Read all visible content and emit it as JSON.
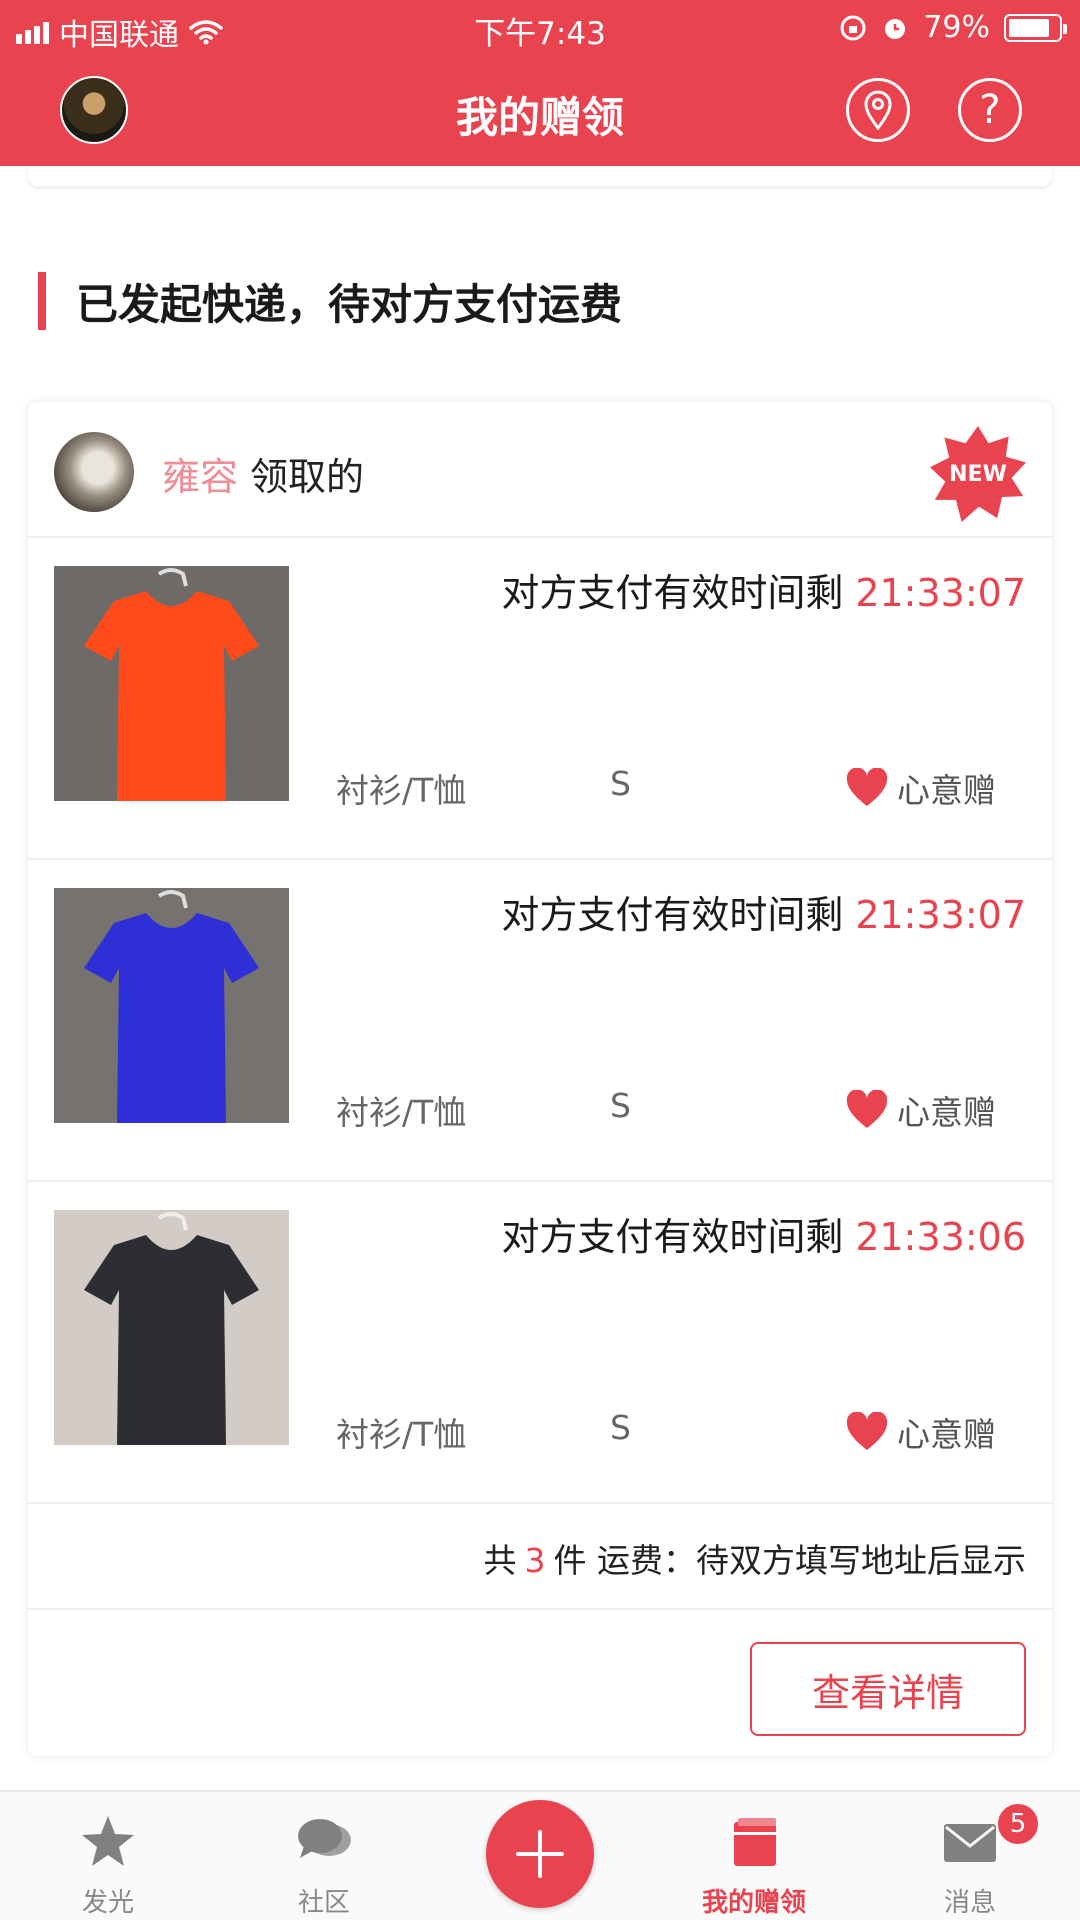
{
  "status_bar": {
    "carrier": "中国联通",
    "time": "下午7:43",
    "battery_percent": "79%",
    "battery_level": 0.79
  },
  "header": {
    "title": "我的赠领",
    "location_icon": "location-pin-icon",
    "help_icon": "help-question-icon"
  },
  "section": {
    "title": "已发起快递，待对方支付运费"
  },
  "card": {
    "receiver_name": "雍容",
    "receiver_suffix": "领取的",
    "new_badge": "NEW",
    "items": [
      {
        "timer_label": "对方支付有效时间剩",
        "timer": "21:33:07",
        "category": "衬衫/T恤",
        "size": "S",
        "gift_type": "心意赠",
        "color": "#ff4a1c"
      },
      {
        "timer_label": "对方支付有效时间剩",
        "timer": "21:33:07",
        "category": "衬衫/T恤",
        "size": "S",
        "gift_type": "心意赠",
        "color": "#2e2fd6"
      },
      {
        "timer_label": "对方支付有效时间剩",
        "timer": "21:33:06",
        "category": "衬衫/T恤",
        "size": "S",
        "gift_type": "心意赠",
        "color": "#2c2e33"
      }
    ],
    "summary": {
      "prefix": "共",
      "count": "3",
      "suffix": "件 运费：待双方填写地址后显示"
    },
    "detail_button": "查看详情"
  },
  "tabbar": {
    "tabs": [
      {
        "label": "发光",
        "icon": "star-icon"
      },
      {
        "label": "社区",
        "icon": "chat-bubbles-icon"
      },
      {
        "label": "我的赠领",
        "icon": "gift-book-icon",
        "active": true
      },
      {
        "label": "消息",
        "icon": "envelope-icon"
      }
    ],
    "add_icon": "plus-icon",
    "message_badge": "5"
  },
  "colors": {
    "brand_red": "#e8434f",
    "receiver_pink": "#ee8d95"
  }
}
